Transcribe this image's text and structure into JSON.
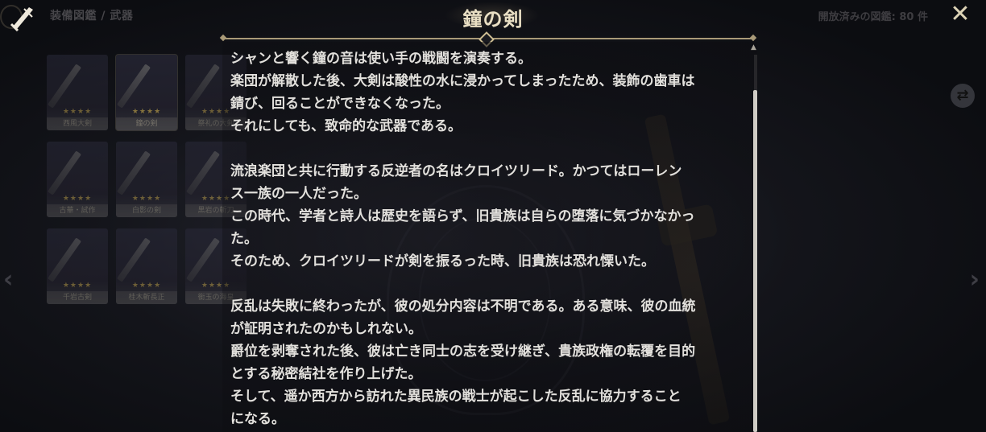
{
  "header": {
    "breadcrumb": "装備図鑑 / 武器",
    "counter": "開放済みの図鑑: 80 件",
    "title": "鐘の剣",
    "close_label": "✕"
  },
  "grid": {
    "rows": [
      [
        {
          "name": "西風大剣",
          "stars": "★★★★",
          "selected": false
        },
        {
          "name": "鐘の剣",
          "stars": "★★★★",
          "selected": true
        },
        {
          "name": "祭礼の大剣",
          "stars": "★★★★",
          "selected": false
        }
      ],
      [
        {
          "name": "古華・試作",
          "stars": "★★★★",
          "selected": false
        },
        {
          "name": "白影の剣",
          "stars": "★★★★",
          "selected": false
        },
        {
          "name": "黒岩の斬刀",
          "stars": "★★★★",
          "selected": false
        }
      ],
      [
        {
          "name": "千岩古剣",
          "stars": "★★★★",
          "selected": false
        },
        {
          "name": "桂木斬長正",
          "stars": "★★★★",
          "selected": false
        },
        {
          "name": "銜玉の海皇",
          "stars": "★★★★",
          "selected": false
        }
      ]
    ]
  },
  "story": {
    "lines": [
      "シャンと響く鐘の音は使い手の戦闘を演奏する。",
      "楽団が解散した後、大剣は酸性の水に浸かってしまったため、装飾の歯車は",
      "錆び、回ることができなくなった。",
      "それにしても、致命的な武器である。",
      "",
      "流浪楽団と共に行動する反逆者の名はクロイツリード。かつてはローレン",
      "ス一族の一人だった。",
      "この時代、学者と詩人は歴史を語らず、旧貴族は自らの堕落に気づかなかっ",
      "た。",
      "そのため、クロイツリードが剣を振るった時、旧貴族は恐れ慄いた。",
      "",
      "反乱は失敗に終わったが、彼の処分内容は不明である。ある意味、彼の血統",
      "が証明されたのかもしれない。",
      "爵位を剥奪された後、彼は亡き同士の志を受け継ぎ、貴族政権の転覆を目的",
      "とする秘密結社を作り上げた。",
      "そして、遥か西方から訪れた異民族の戦士が起こした反乱に協力すること",
      "になる。"
    ]
  },
  "nav": {
    "left_arrow": "‹",
    "right_arrow": "›",
    "swap_icon": "⇄"
  }
}
